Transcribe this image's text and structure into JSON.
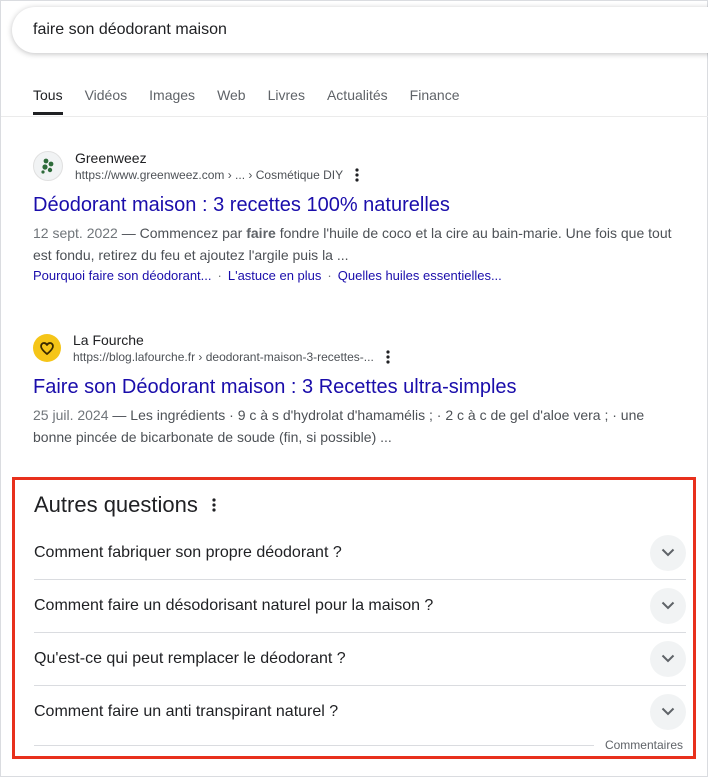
{
  "search": {
    "query": "faire son déodorant maison"
  },
  "tabs": [
    {
      "label": "Tous",
      "active": true
    },
    {
      "label": "Vidéos"
    },
    {
      "label": "Images"
    },
    {
      "label": "Web"
    },
    {
      "label": "Livres"
    },
    {
      "label": "Actualités"
    },
    {
      "label": "Finance"
    }
  ],
  "results": [
    {
      "site_name": "Greenweez",
      "url": "https://www.greenweez.com › ... › Cosmétique DIY",
      "title": "Déodorant maison : 3 recettes 100% naturelles",
      "date": "12 sept. 2022",
      "snippet_before": " — Commencez par ",
      "snippet_bold": "faire",
      "snippet_after": " fondre l'huile de coco et la cire au bain-marie. Une fois que tout est fondu, retirez du feu et ajoutez l'argile puis la ...",
      "sitelinks": [
        "Pourquoi faire son déodorant...",
        "L'astuce en plus",
        "Quelles huiles essentielles..."
      ],
      "favicon_color": "#2e6b3a"
    },
    {
      "site_name": "La Fourche",
      "url": "https://blog.lafourche.fr › deodorant-maison-3-recettes-...",
      "title": "Faire son Déodorant maison : 3 Recettes ultra-simples",
      "date": "25 juil. 2024",
      "snippet": " — Les ingrédients · 9 c à s d'hydrolat d'hamamélis ; · 2 c à c de gel d'aloe vera ; · une bonne pincée de bicarbonate de soude (fin, si possible) ...",
      "favicon_color": "#f5c518"
    }
  ],
  "paa": {
    "title": "Autres questions",
    "questions": [
      "Comment fabriquer son propre déodorant ?",
      "Comment faire un désodorisant naturel pour la maison ?",
      "Qu'est-ce qui peut remplacer le déodorant ?",
      "Comment faire un anti transpirant naturel ?"
    ],
    "feedback": "Commentaires"
  }
}
